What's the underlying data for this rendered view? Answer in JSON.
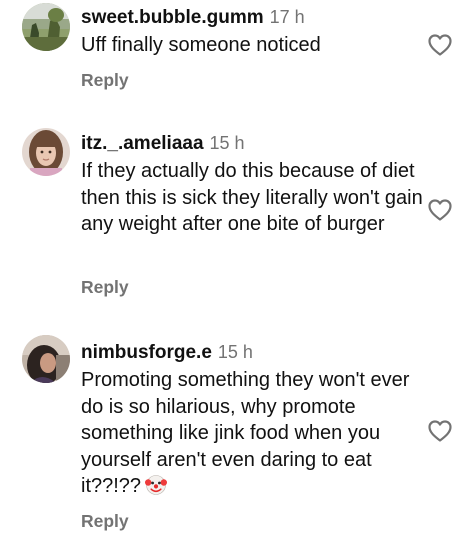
{
  "comments": [
    {
      "username": "sweet.bubble.gumm",
      "time": "17 h",
      "text": "Uff finally someone noticed",
      "reply_label": "Reply"
    },
    {
      "username": "itz._.ameliaaa",
      "time": "15 h",
      "text": "If they actually do this because of diet then this is sick they literally won't gain any weight after one bite of burger",
      "reply_label": "Reply"
    },
    {
      "username": "nimbusforge.e",
      "time": "15 h",
      "text": "Promoting something they won't ever do is so hilarious, why promote something like jink food when you yourself aren't even daring to eat it??!??",
      "emoji": "clown-face-emoji",
      "reply_label": "Reply"
    }
  ],
  "icons": {
    "like": "heart-outline-icon",
    "avatar": "profile-avatar"
  },
  "colors": {
    "text": "#111111",
    "secondary": "#737373",
    "background": "#ffffff"
  }
}
